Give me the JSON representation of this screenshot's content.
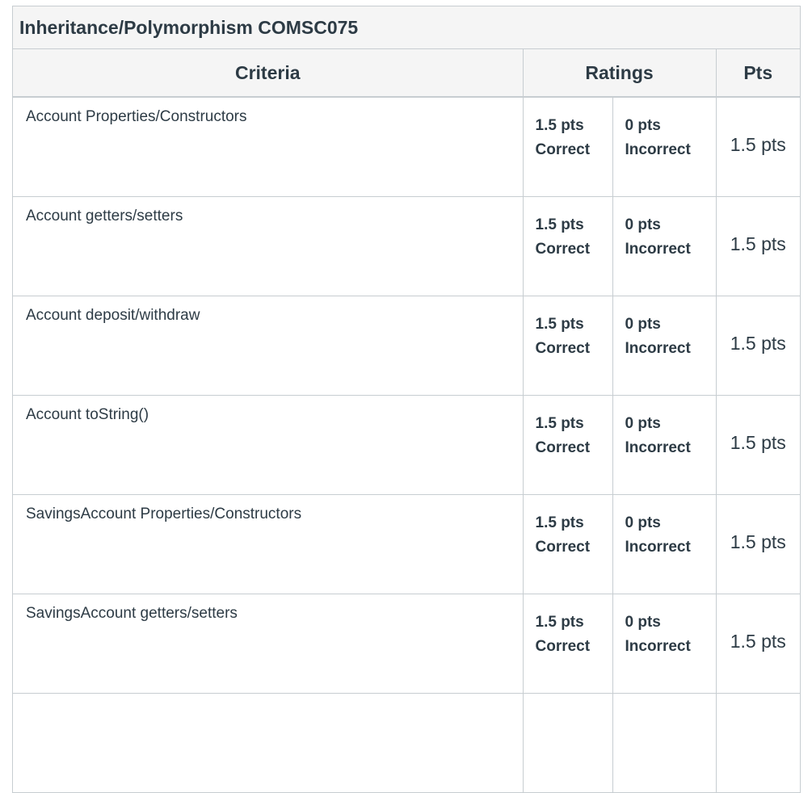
{
  "rubric": {
    "title": "Inheritance/Polymorphism COMSC075",
    "headers": {
      "criteria": "Criteria",
      "ratings": "Ratings",
      "pts": "Pts"
    },
    "rows": [
      {
        "criterion": "Account Properties/Constructors",
        "ratings": [
          {
            "points": "1.5 pts",
            "label": "Correct"
          },
          {
            "points": "0 pts",
            "label": "Incorrect"
          }
        ],
        "pts": "1.5 pts"
      },
      {
        "criterion": "Account getters/setters",
        "ratings": [
          {
            "points": "1.5 pts",
            "label": "Correct"
          },
          {
            "points": "0 pts",
            "label": "Incorrect"
          }
        ],
        "pts": "1.5 pts"
      },
      {
        "criterion": "Account deposit/withdraw",
        "ratings": [
          {
            "points": "1.5 pts",
            "label": "Correct"
          },
          {
            "points": "0 pts",
            "label": "Incorrect"
          }
        ],
        "pts": "1.5 pts"
      },
      {
        "criterion": "Account toString()",
        "ratings": [
          {
            "points": "1.5 pts",
            "label": "Correct"
          },
          {
            "points": "0 pts",
            "label": "Incorrect"
          }
        ],
        "pts": "1.5 pts"
      },
      {
        "criterion": "SavingsAccount Properties/Constructors",
        "ratings": [
          {
            "points": "1.5 pts",
            "label": "Correct"
          },
          {
            "points": "0 pts",
            "label": "Incorrect"
          }
        ],
        "pts": "1.5 pts"
      },
      {
        "criterion": "SavingsAccount getters/setters",
        "ratings": [
          {
            "points": "1.5 pts",
            "label": "Correct"
          },
          {
            "points": "0 pts",
            "label": "Incorrect"
          }
        ],
        "pts": "1.5 pts"
      }
    ]
  }
}
